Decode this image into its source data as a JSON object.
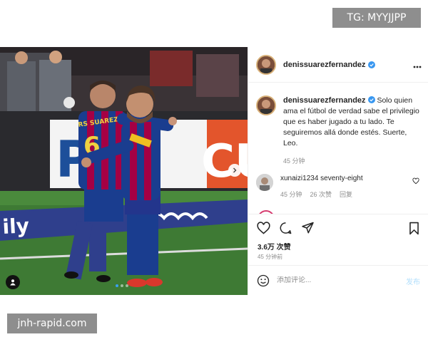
{
  "watermarks": {
    "top": "TG: MYYJJPP",
    "bottom": "jnh-rapid.com"
  },
  "photo": {
    "board_text_left": "PS",
    "board_text_right": "CU",
    "ad_text": "ily",
    "shirt_text": "RS SUAREZ",
    "shirt_number": "6",
    "carousel": {
      "current": 1,
      "total": 3
    }
  },
  "header": {
    "username": "denissuarezfernandez",
    "more_icon": "more-horizontal-icon"
  },
  "caption": {
    "username": "denissuarezfernandez",
    "text": "Solo quien ama el fútbol de verdad sabe el privilegio que es haber jugado a tu lado. Te seguiremos allá donde estés. Suerte, Leo.",
    "time": "45 分钟"
  },
  "comments": [
    {
      "username": "xunaizi1234",
      "text": "seventy-eight",
      "time": "45 分钟",
      "likes": "26 次赞",
      "reply": "回复"
    }
  ],
  "actions": {
    "likes": "3.6万 次赞",
    "posted_ago": "45 分钟前"
  },
  "comment_box": {
    "placeholder": "添加评论...",
    "post_label": "发布"
  },
  "colors": {
    "verified": "#3897f0",
    "barca_blue": "#1a3d8f",
    "barca_red": "#a50044",
    "pitch": "#3e7a34"
  }
}
